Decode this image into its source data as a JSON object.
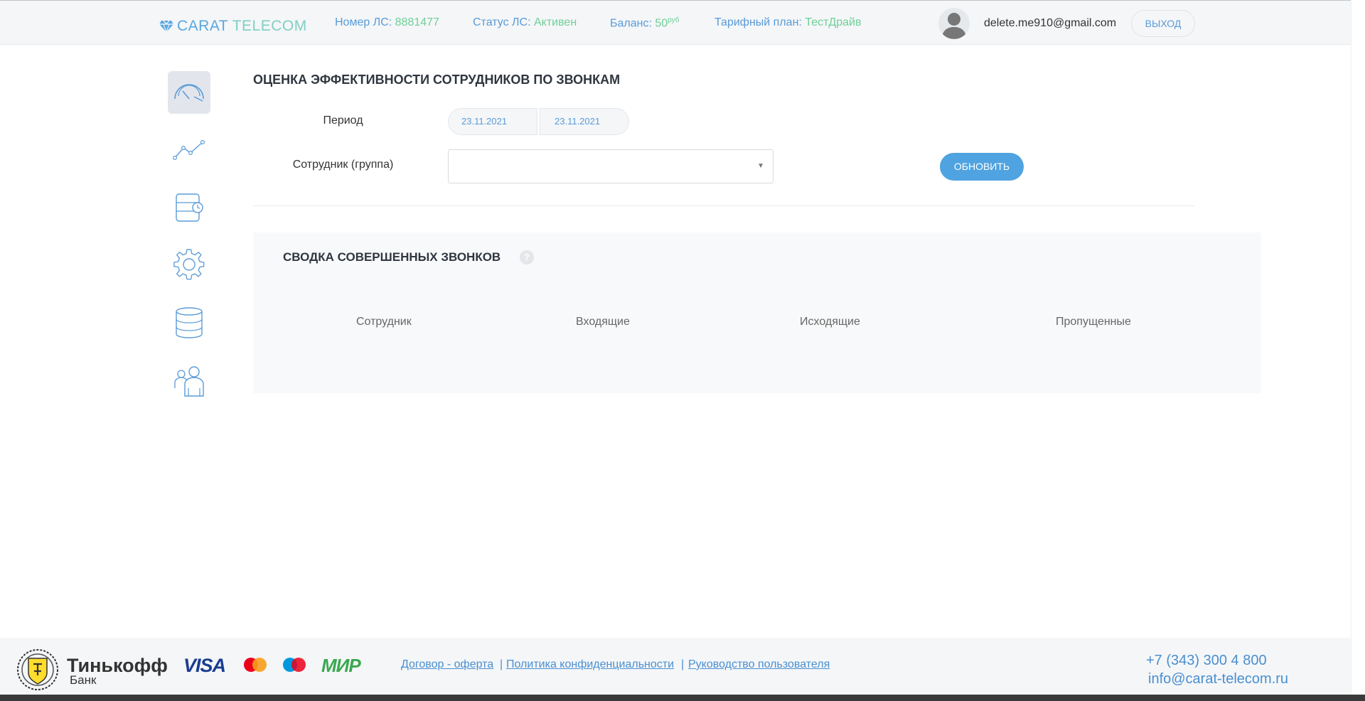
{
  "header": {
    "logo": {
      "part1": "CARAT",
      "part2": "TELECOM"
    },
    "account_label": "Номер ЛС:",
    "account_value": "8881477",
    "status_label": "Статус ЛС:",
    "status_value": "Активен",
    "balance_label": "Баланс:",
    "balance_value": "50",
    "balance_unit": "руб",
    "tariff_label": "Тарифный план:",
    "tariff_value": "ТестДрайв",
    "user_email": "delete.me910@gmail.com",
    "logout_label": "ВЫХОД"
  },
  "sidebar": {
    "items": [
      {
        "icon": "speedometer-icon",
        "active": true
      },
      {
        "icon": "line-chart-icon",
        "active": false
      },
      {
        "icon": "server-clock-icon",
        "active": false
      },
      {
        "icon": "gear-icon",
        "active": false
      },
      {
        "icon": "database-icon",
        "active": false
      },
      {
        "icon": "users-icon",
        "active": false
      }
    ]
  },
  "main": {
    "title": "ОЦЕНКА ЭФФЕКТИВНОСТИ СОТРУДНИКОВ ПО ЗВОНКАМ",
    "period_label": "Период",
    "date_from": "23.11.2021",
    "date_to": "23.11.2021",
    "employee_label": "Сотрудник (группа)",
    "employee_value": "",
    "refresh_label": "ОБНОВИТЬ",
    "summary": {
      "title": "СВОДКА СОВЕРШЕННЫХ ЗВОНКОВ",
      "help": "?",
      "columns": [
        "Сотрудник",
        "Входящие",
        "Исходящие",
        "Пропущенные"
      ]
    }
  },
  "footer": {
    "bank_name": "Тинькофф",
    "bank_sub": "Банк",
    "visa": "VISA",
    "mir": "МИР",
    "links": [
      "Договор - оферта",
      "Политика конфиденциальности",
      "Руководство пользователя"
    ],
    "separator": "|",
    "phone": "+7 (343) 300 4 800",
    "email": "info@carat-telecom.ru"
  },
  "colors": {
    "accent": "#4fa3e0",
    "value_green": "#6fcf97",
    "header_bg": "#f4f6f8"
  }
}
